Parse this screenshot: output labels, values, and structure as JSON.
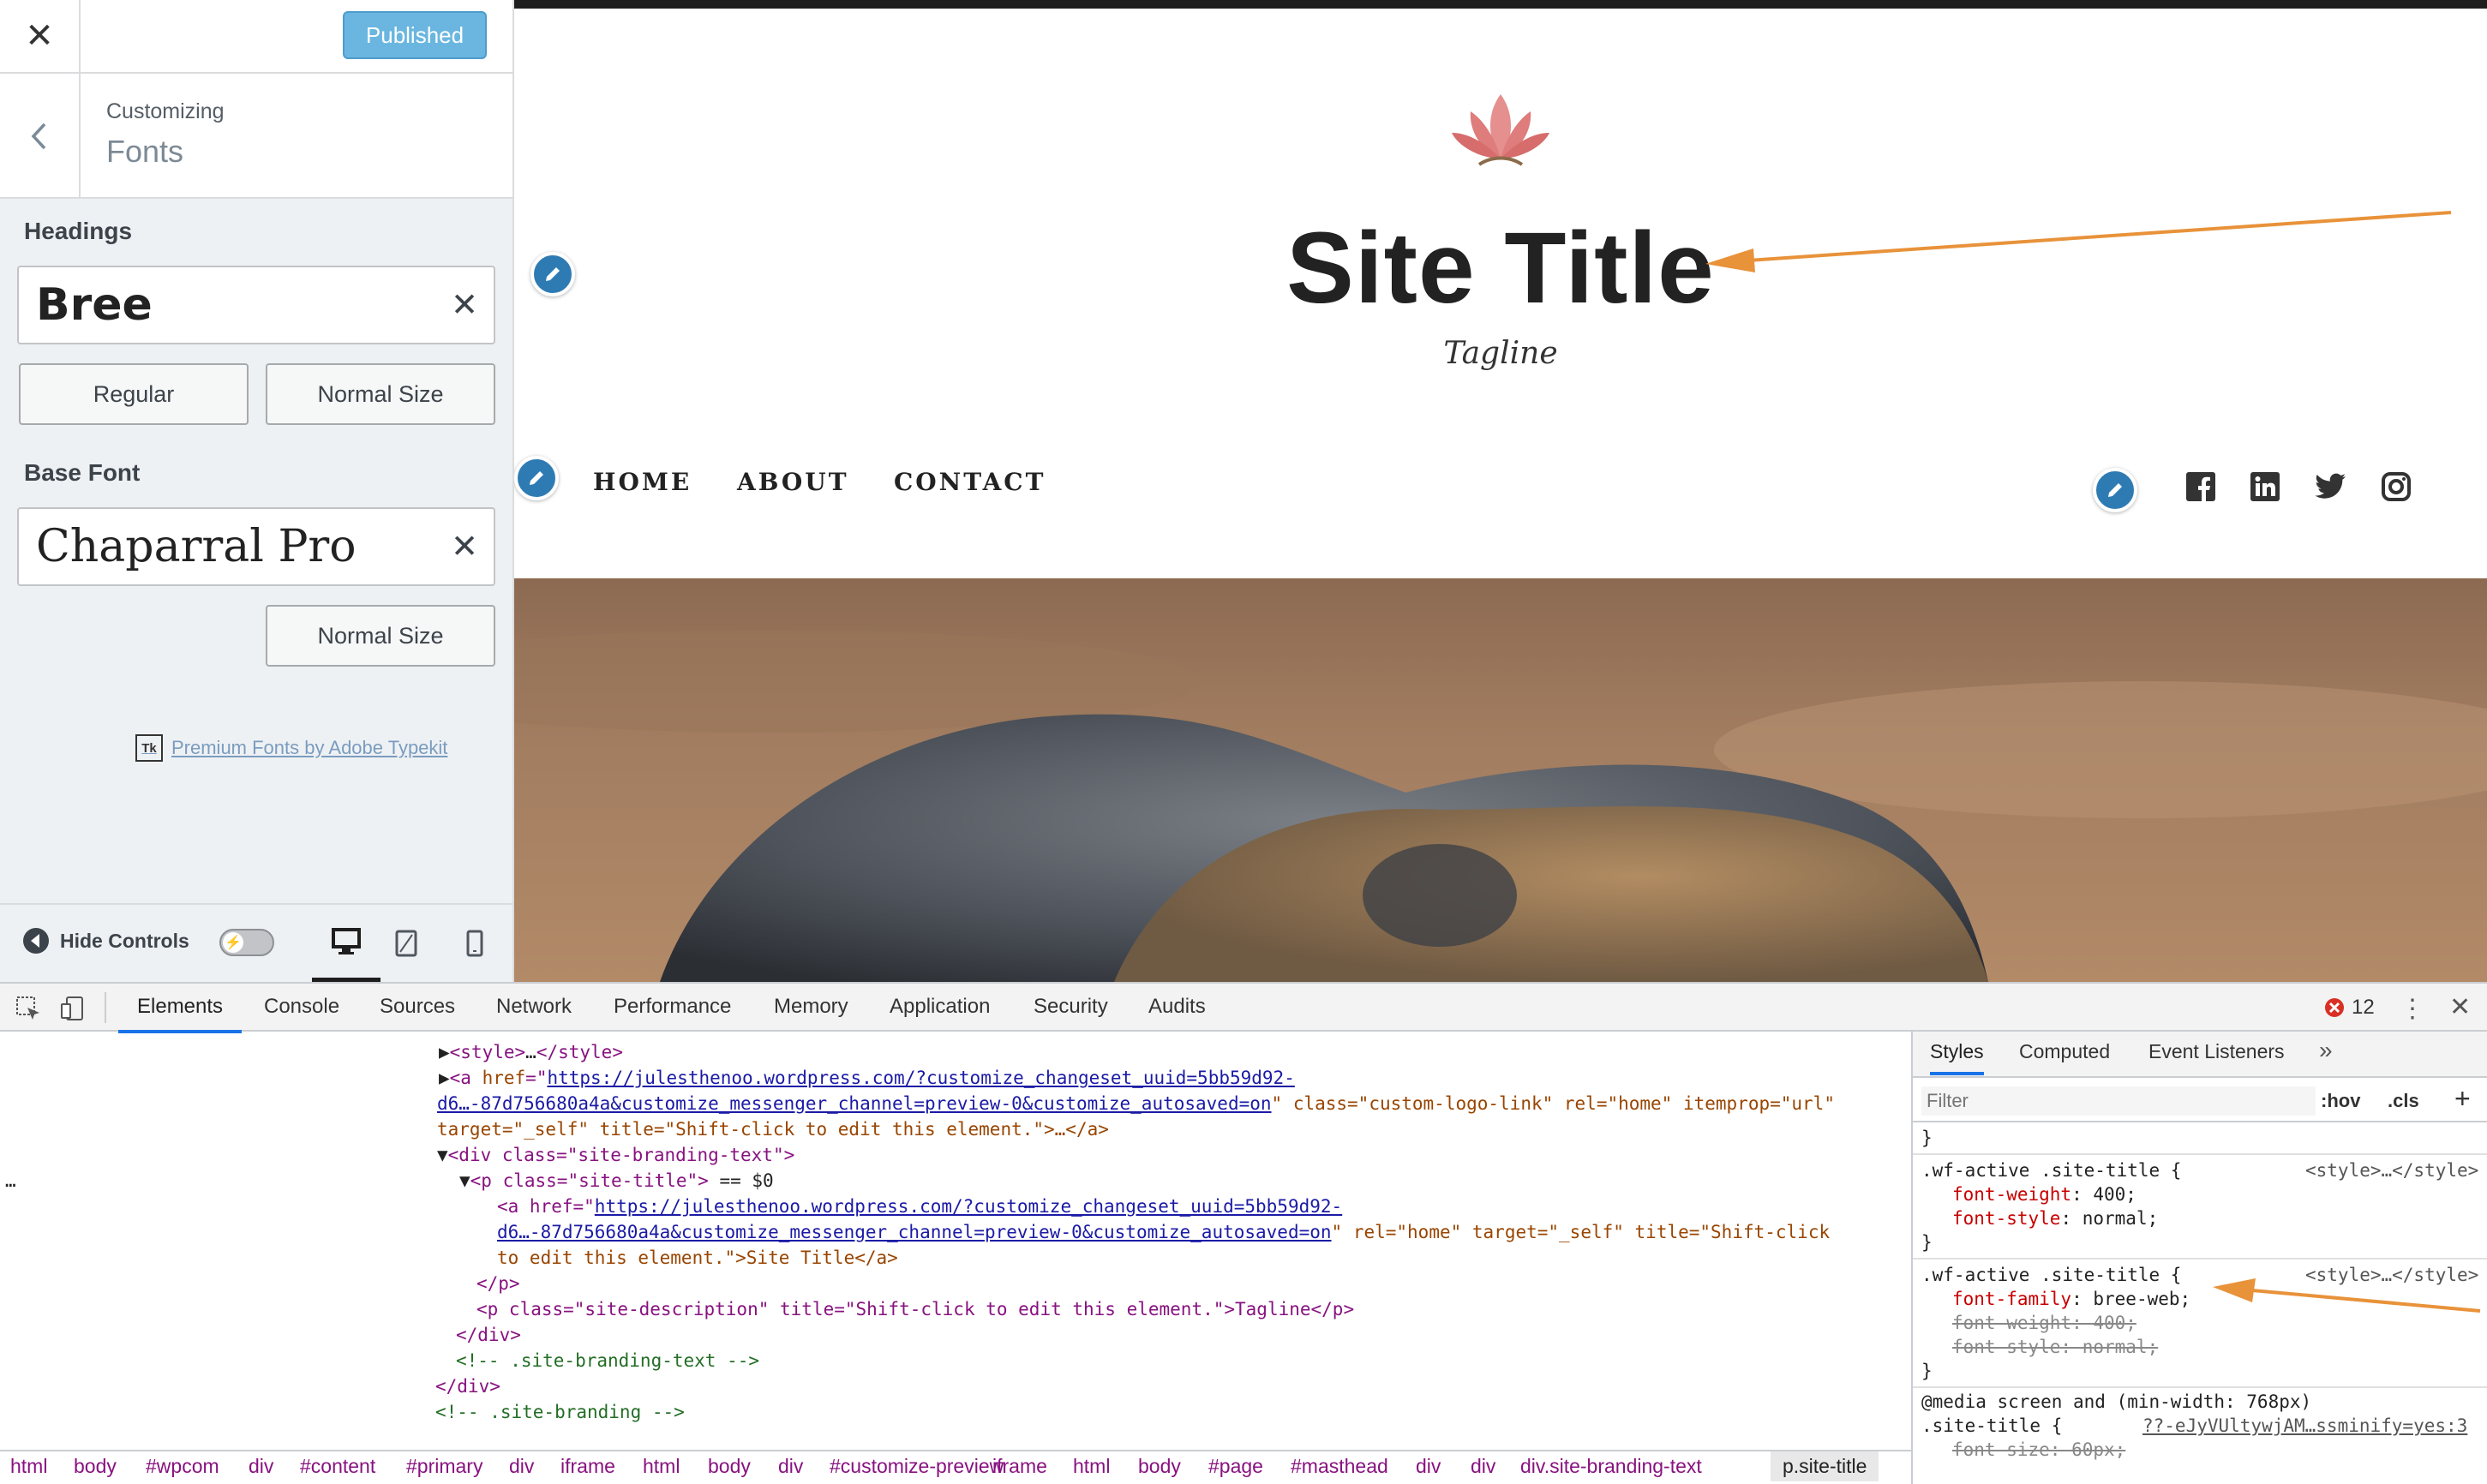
{
  "customizer": {
    "close_symbol": "✕",
    "published_label": "Published",
    "breadcrumb_parent": "Customizing",
    "section_title": "Fonts",
    "headings": {
      "label": "Headings",
      "font_value": "Bree",
      "clear_symbol": "✕",
      "style_option": "Regular",
      "size_option": "Normal Size"
    },
    "base_font": {
      "label": "Base Font",
      "font_value": "Chaparral Pro",
      "clear_symbol": "✕",
      "size_option": "Normal Size"
    },
    "typekit_badge": "Tk",
    "typekit_link": "Premium Fonts by Adobe Typekit",
    "hide_controls_label": "Hide Controls"
  },
  "preview": {
    "site_title": "Site Title",
    "tagline": "Tagline",
    "nav": [
      "HOME",
      "ABOUT",
      "CONTACT"
    ],
    "accent_color": "#e8923a",
    "edit_color": "#2e7bb4"
  },
  "devtools": {
    "tabs": [
      "Elements",
      "Console",
      "Sources",
      "Network",
      "Performance",
      "Memory",
      "Application",
      "Security",
      "Audits"
    ],
    "active_tab": "Elements",
    "error_count": "12",
    "html": {
      "l1_tag": "<style>",
      "l1_ellipsis": "…",
      "l1_close": "</style>",
      "l2_open": "<a ",
      "l2_href_attr": "href",
      "l2_href_part1": "https://julesthenoo.wordpress.com/?customize_changeset_uuid=5bb59d92-",
      "l3_href_part2": "d6…-87d756680a4a&customize_messenger_channel=preview-0&customize_autosaved=on",
      "l3_rest": "\" class=\"custom-logo-link\" rel=\"home\" itemprop=\"url\"",
      "l4_text": "target=\"_self\" title=\"Shift-click to edit this element.\">…</a>",
      "l5_text": "<div class=\"site-branding-text\">",
      "l6_text": "<p class=\"site-title\">",
      "l6_marker": "== $0",
      "l7_text": "<a href=\"",
      "l7_href": "https://julesthenoo.wordpress.com/?customize_changeset_uuid=5bb59d92-",
      "l8_href": "d6…-87d756680a4a&customize_messenger_channel=preview-0&customize_autosaved=on",
      "l8_rest": "\" rel=\"home\" target=\"_self\" title=\"Shift-click",
      "l9_text": "to edit this element.\">Site Title</a>",
      "l10_text": "</p>",
      "l11_text": "<p class=\"site-description\" title=\"Shift-click to edit this element.\">Tagline</p>",
      "l12_text": "</div>",
      "l13_text": "<!-- .site-branding-text -->",
      "l14_text": "</div>",
      "l15_text": "<!-- .site-branding -->"
    },
    "breadcrumb": [
      "html",
      "body",
      "#wpcom",
      "div",
      "#content",
      "#primary",
      "div",
      "iframe",
      "html",
      "body",
      "div",
      "#customize-preview",
      "iframe",
      "html",
      "body",
      "#page",
      "#masthead",
      "div",
      "div",
      "div.site-branding-text",
      "p.site-title"
    ],
    "styles": {
      "tabs": [
        "Styles",
        "Computed",
        "Event Listeners"
      ],
      "more": "»",
      "filter_placeholder": "Filter",
      "hov": ":hov",
      "cls": ".cls",
      "add": "+",
      "brace_close": "}",
      "rule1_selector": ".wf-active .site-title {",
      "rule1_source": "<style>…</style>",
      "rule1_p1": "font-weight",
      "rule1_v1": "400;",
      "rule1_p2": "font-style",
      "rule1_v2": "normal;",
      "rule2_selector": ".wf-active .site-title {",
      "rule2_source": "<style>…</style>",
      "rule2_p1": "font-family",
      "rule2_v1": "bree-web;",
      "rule2_p2": "font-weight: 400;",
      "rule2_p3": "font-style: normal;",
      "media": "@media screen and (min-width: 768px)",
      "rule3_selector": ".site-title {",
      "rule3_source": "??-eJyVUltywjAM…ssminify=yes:3",
      "rule3_p1": "font-size: 60px;"
    }
  }
}
